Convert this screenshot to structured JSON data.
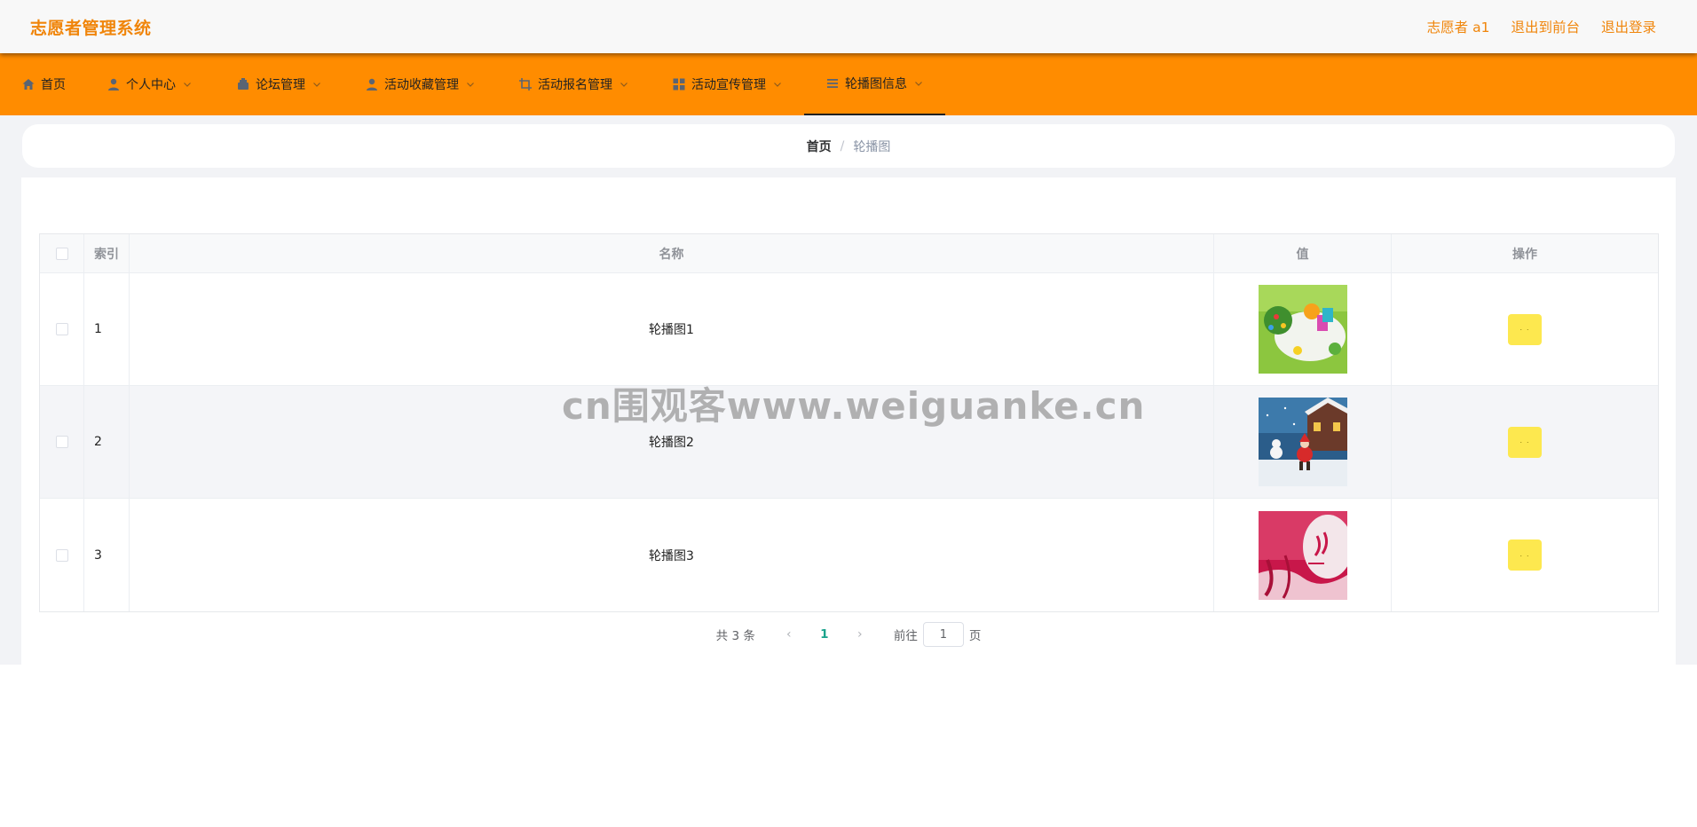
{
  "header": {
    "app_title": "志愿者管理系统",
    "user_label": "志愿者 a1",
    "back_to_front": "退出到前台",
    "logout": "退出登录"
  },
  "nav": {
    "items": [
      {
        "label": "首页",
        "icon": "home-icon",
        "has_dropdown": false
      },
      {
        "label": "个人中心",
        "icon": "user-icon",
        "has_dropdown": true
      },
      {
        "label": "论坛管理",
        "icon": "forum-icon",
        "has_dropdown": true
      },
      {
        "label": "活动收藏管理",
        "icon": "user-icon",
        "has_dropdown": true
      },
      {
        "label": "活动报名管理",
        "icon": "crop-icon",
        "has_dropdown": true
      },
      {
        "label": "活动宣传管理",
        "icon": "grid-icon",
        "has_dropdown": true
      },
      {
        "label": "轮播图信息",
        "icon": "list-icon",
        "has_dropdown": true,
        "active": true
      }
    ]
  },
  "breadcrumb": {
    "home": "首页",
    "separator": "/",
    "current": "轮播图"
  },
  "table": {
    "columns": [
      "索引",
      "名称",
      "值",
      "操作"
    ],
    "rows": [
      {
        "index": "1",
        "name": "轮播图1",
        "image": "carousel-thumbnail-1"
      },
      {
        "index": "2",
        "name": "轮播图2",
        "image": "carousel-thumbnail-2"
      },
      {
        "index": "3",
        "name": "轮播图3",
        "image": "carousel-thumbnail-3"
      }
    ],
    "action_label": "· ·"
  },
  "pagination": {
    "total": "共 3 条",
    "prev": "‹",
    "current_page": "1",
    "next": "›",
    "goto_label": "前往",
    "goto_value": "1",
    "page_unit": "页"
  },
  "watermark": "cn围观客www.weiguanke.cn",
  "colors": {
    "brand_orange": "#ff8c00",
    "title_orange": "#f0850a",
    "action_yellow": "#fde84f",
    "page_active": "#1aa38c"
  }
}
